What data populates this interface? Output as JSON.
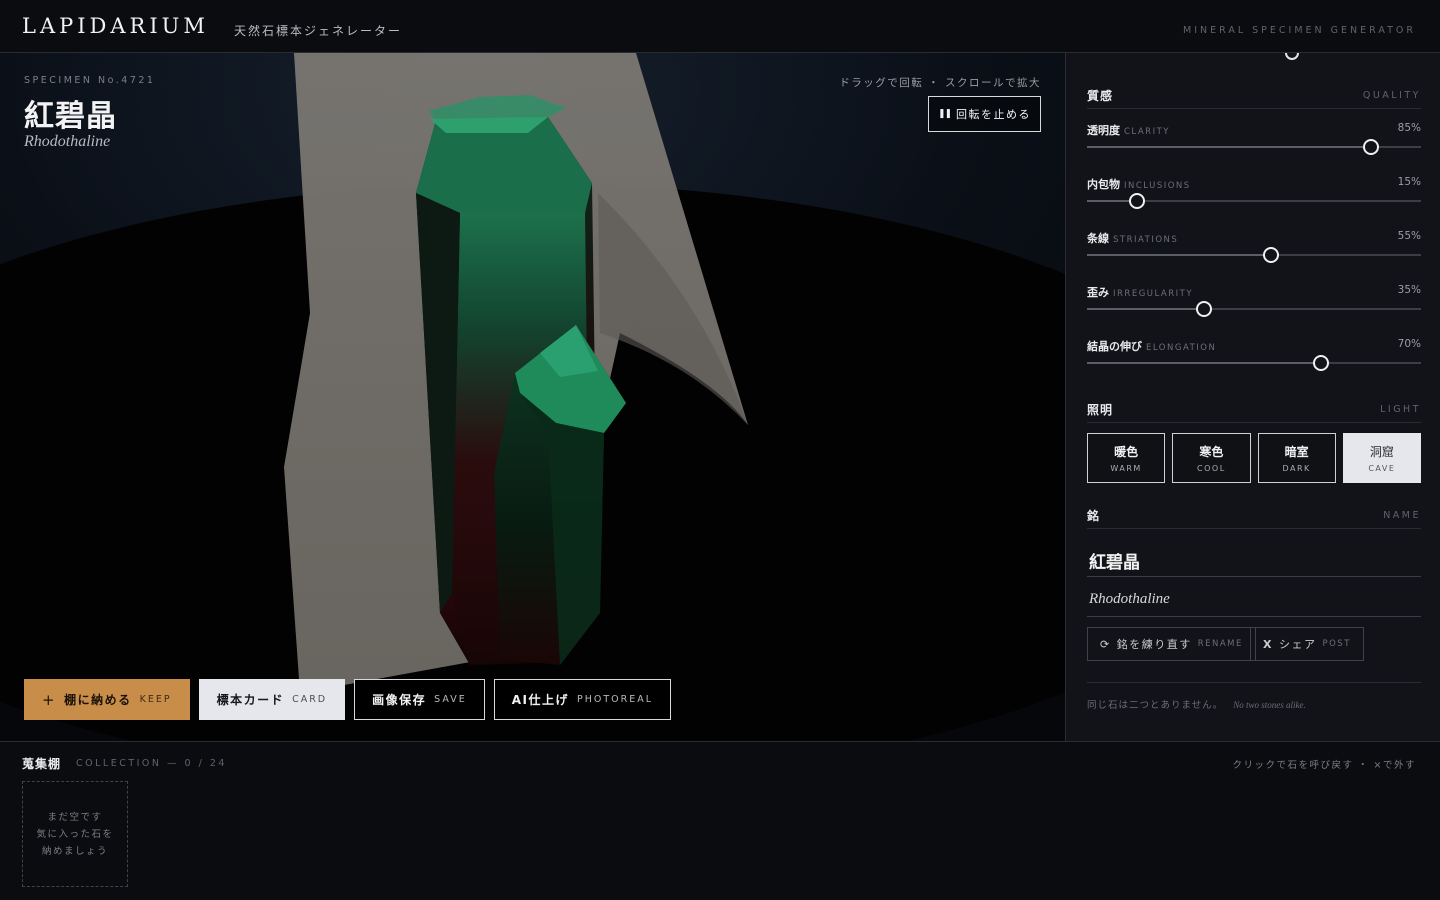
{
  "header": {
    "brand": "LAPIDARIUM",
    "subtitle": "天然石標本ジェネレーター",
    "tagline": "MINERAL SPECIMEN GENERATOR"
  },
  "viewport": {
    "specimen_no": "SPECIMEN No.4721",
    "name_jp": "紅碧晶",
    "name_en": "Rhodothaline",
    "hint": "ドラッグで回転 ・ スクロールで拡大",
    "stop_rotation": "回転を止める",
    "actions": {
      "keep_jp": "棚に納める",
      "keep_en": "KEEP",
      "card_jp": "標本カード",
      "card_en": "CARD",
      "save_jp": "画像保存",
      "save_en": "SAVE",
      "ai_jp": "AI仕上げ",
      "ai_en": "PHOTOREAL"
    }
  },
  "panel": {
    "quality": {
      "title_jp": "質感",
      "title_en": "QUALITY",
      "sliders": [
        {
          "jp": "透明度",
          "en": "CLARITY",
          "value": 85,
          "display": "85%"
        },
        {
          "jp": "内包物",
          "en": "INCLUSIONS",
          "value": 15,
          "display": "15%"
        },
        {
          "jp": "条線",
          "en": "STRIATIONS",
          "value": 55,
          "display": "55%"
        },
        {
          "jp": "歪み",
          "en": "IRREGULARITY",
          "value": 35,
          "display": "35%"
        },
        {
          "jp": "結晶の伸び",
          "en": "ELONGATION",
          "value": 70,
          "display": "70%"
        }
      ]
    },
    "light": {
      "title_jp": "照明",
      "title_en": "LIGHT",
      "options": [
        {
          "jp": "暖色",
          "en": "WARM"
        },
        {
          "jp": "寒色",
          "en": "COOL"
        },
        {
          "jp": "暗室",
          "en": "DARK"
        },
        {
          "jp": "洞窟",
          "en": "CAVE"
        }
      ],
      "selected": "CAVE"
    },
    "name": {
      "title_jp": "銘",
      "title_en": "NAME",
      "value_jp": "紅碧晶",
      "value_en": "Rhodothaline",
      "rename_jp": "銘を練り直す",
      "rename_en": "RENAME",
      "post_jp": "シェア",
      "post_en": "POST"
    },
    "note_jp": "同じ石は二つとありません。",
    "note_en": "No two stones alike."
  },
  "collection": {
    "title": "蒐集棚",
    "count": "COLLECTION — 0 / 24",
    "hint": "クリックで石を呼び戻す ・ ×で外す",
    "empty_line1": "まだ空です",
    "empty_line2": "気に入った石を",
    "empty_line3": "納めましょう"
  },
  "colors": {
    "accent": "#c98d4a",
    "crystal_green": "#1f8a5a",
    "crystal_red": "#6a1418"
  }
}
